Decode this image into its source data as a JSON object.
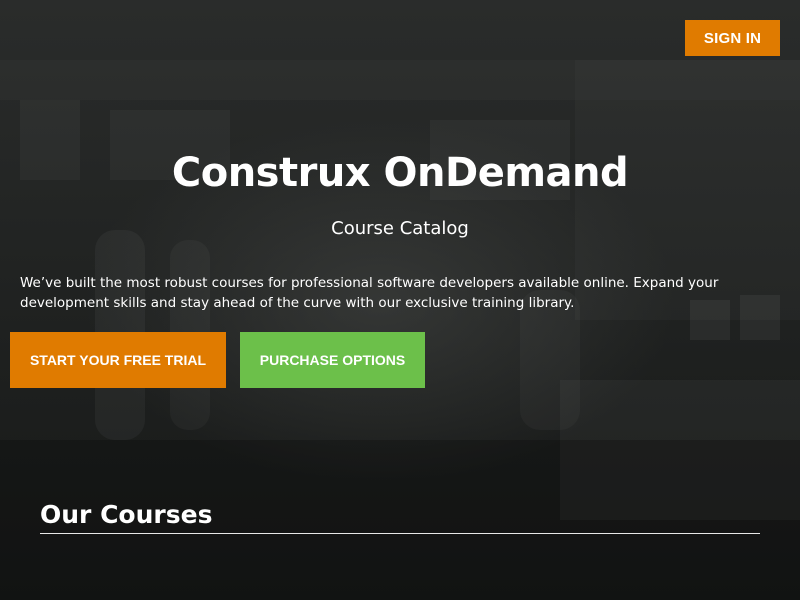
{
  "header": {
    "signin_label": "SIGN IN"
  },
  "hero": {
    "title": "Construx OnDemand",
    "subtitle": "Course Catalog",
    "description": "We’ve built the most robust courses for professional software developers available online. Expand your development skills and stay ahead of the curve with our exclusive training library.",
    "trial_button_label": "START YOUR FREE TRIAL",
    "purchase_button_label": "PURCHASE OPTIONS"
  },
  "courses": {
    "section_title": "Our Courses"
  },
  "colors": {
    "accent_orange": "#e07b00",
    "accent_green": "#6cc04a",
    "hero_background": "#1d1f1e",
    "text": "#ffffff"
  }
}
